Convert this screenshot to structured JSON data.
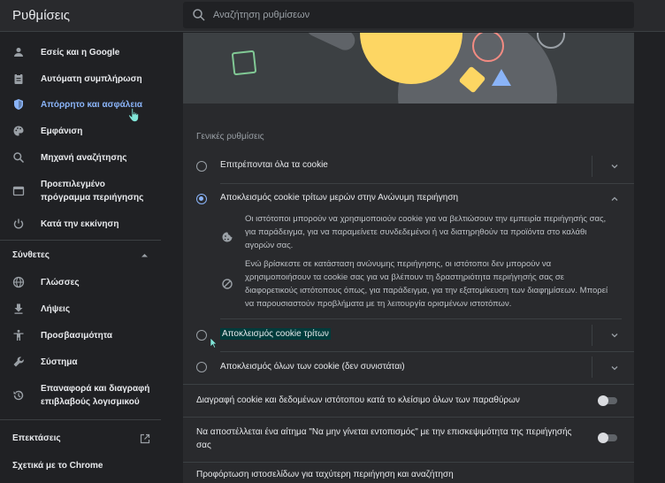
{
  "app": {
    "title": "Ρυθμίσεις"
  },
  "search": {
    "placeholder": "Αναζήτηση ρυθμίσεων"
  },
  "sidebar": {
    "items": [
      {
        "label": "Εσείς και η Google",
        "icon": "person-icon"
      },
      {
        "label": "Αυτόματη συμπλήρωση",
        "icon": "clipboard-icon"
      },
      {
        "label": "Απόρρητο και ασφάλεια",
        "icon": "shield-icon",
        "active": true
      },
      {
        "label": "Εμφάνιση",
        "icon": "palette-icon"
      },
      {
        "label": "Μηχανή αναζήτησης",
        "icon": "search-icon"
      },
      {
        "label": "Προεπιλεγμένο πρόγραμμα περιήγησης",
        "icon": "browser-icon"
      },
      {
        "label": "Κατά την εκκίνηση",
        "icon": "power-icon"
      }
    ],
    "advanced_header": "Σύνθετες",
    "advanced_items": [
      {
        "label": "Γλώσσες",
        "icon": "globe-icon"
      },
      {
        "label": "Λήψεις",
        "icon": "download-icon"
      },
      {
        "label": "Προσβασιμότητα",
        "icon": "accessibility-icon"
      },
      {
        "label": "Σύστημα",
        "icon": "wrench-icon"
      },
      {
        "label": "Επαναφορά και διαγραφή επιβλαβούς λογισμικού",
        "icon": "history-icon"
      }
    ],
    "extensions_label": "Επεκτάσεις",
    "about_label": "Σχετικά με το Chrome"
  },
  "main": {
    "section_title": "Γενικές ρυθμίσεις",
    "options": [
      {
        "label": "Επιτρέπονται όλα τα cookie",
        "checked": false,
        "expanded": false
      },
      {
        "label": "Αποκλεισμός cookie τρίτων μερών στην Ανώνυμη περιήγηση",
        "checked": true,
        "expanded": true
      },
      {
        "label": "Αποκλεισμός cookie τρίτων",
        "checked": false,
        "expanded": false
      },
      {
        "label": "Αποκλεισμός όλων των cookie (δεν συνιστάται)",
        "checked": false,
        "expanded": false
      }
    ],
    "expanded_desc_1": "Οι ιστότοποι μπορούν να χρησιμοποιούν cookie για να βελτιώσουν την εμπειρία περιήγησής σας, για παράδειγμα, για να παραμείνετε συνδεδεμένοι ή να διατηρηθούν τα προϊόντα στο καλάθι αγορών σας.",
    "expanded_desc_2": "Ενώ βρίσκεστε σε κατάσταση ανώνυμης περιήγησης, οι ιστότοποι δεν μπορούν να χρησιμοποιήσουν τα cookie σας για να βλέπουν τη δραστηριότητα περιήγησής σας σε διαφορετικούς ιστότοπους όπως, για παράδειγμα, για την εξατομίκευση των διαφημίσεων. Μπορεί να παρουσιαστούν προβλήματα με τη λειτουργία ορισμένων ιστοτόπων.",
    "toggles": [
      {
        "label": "Διαγραφή cookie και δεδομένων ιστότοπου κατά το κλείσιμο όλων των παραθύρων",
        "on": false
      },
      {
        "label": "Να αποστέλλεται ένα αίτημα \"Να μην γίνεται εντοπισμός\" με την επισκεψιμότητα της περιήγησής σας",
        "on": false
      }
    ],
    "preload_label": "Προφόρτωση ιστοσελίδων για ταχύτερη περιήγηση και αναζήτηση"
  },
  "colors": {
    "accent": "#8ab4f8",
    "background": "#202124",
    "panel": "#292a2d"
  }
}
